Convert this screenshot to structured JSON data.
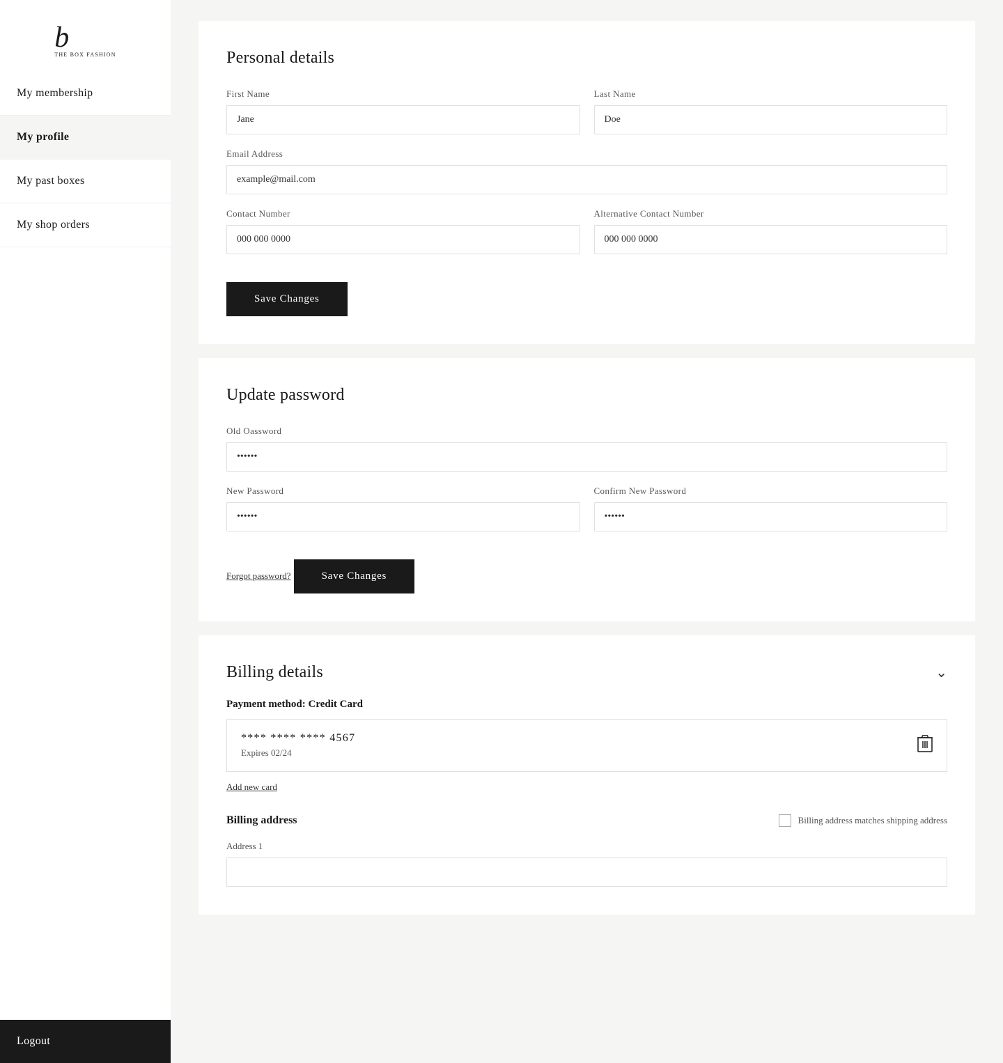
{
  "sidebar": {
    "logo_letter": "b",
    "logo_subtext": "THE BOX FASHION",
    "nav_items": [
      {
        "id": "membership",
        "label": "My membership",
        "active": false
      },
      {
        "id": "profile",
        "label": "My profile",
        "active": true
      },
      {
        "id": "past-boxes",
        "label": "My past boxes",
        "active": false
      },
      {
        "id": "shop-orders",
        "label": "My shop orders",
        "active": false
      }
    ],
    "logout_label": "Logout"
  },
  "personal_details": {
    "section_title": "Personal details",
    "first_name_label": "First Name",
    "first_name_value": "Jane",
    "last_name_label": "Last Name",
    "last_name_value": "Doe",
    "email_label": "Email Address",
    "email_value": "example@mail.com",
    "contact_label": "Contact Number",
    "contact_value": "000 000 0000",
    "alt_contact_label": "Alternative Contact Number",
    "alt_contact_value": "000 000 0000",
    "save_button": "Save Changes"
  },
  "update_password": {
    "section_title": "Update password",
    "old_password_label": "Old Oassword",
    "old_password_value": "••••••",
    "new_password_label": "New Password",
    "new_password_value": "••••••",
    "confirm_password_label": "Confirm New Password",
    "confirm_password_value": "••••••",
    "forgot_link": "Forgot password?",
    "save_button": "Save Changes"
  },
  "billing_details": {
    "section_title": "Billing details",
    "payment_method_label": "Payment method: Credit Card",
    "card_number": "**** **** **** 4567",
    "card_expiry": "Expires 02/24",
    "add_card_link": "Add new card",
    "billing_address_title": "Billing address",
    "billing_matches_shipping_label": "Billing address matches shipping address",
    "address1_label": "Address 1"
  },
  "icons": {
    "chevron_down": "∨",
    "trash": "🗑"
  }
}
